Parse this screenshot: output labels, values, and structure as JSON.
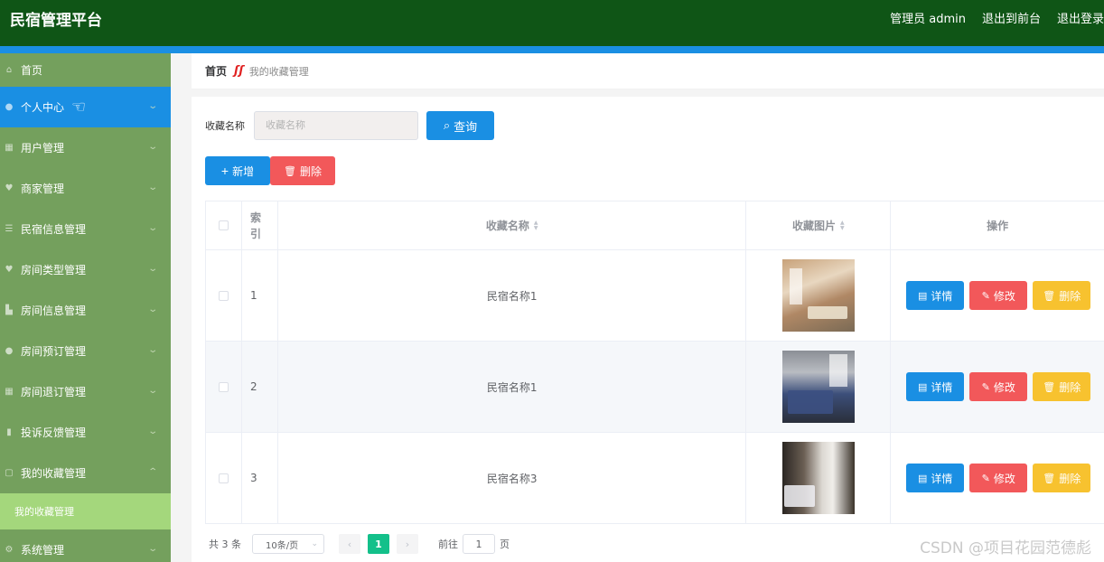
{
  "header": {
    "brand": "民宿管理平台",
    "user": "管理员 admin",
    "to_front": "退出到前台",
    "logout": "退出登录"
  },
  "sidebar": {
    "items": [
      {
        "label": "首页",
        "icon": "home-icon"
      },
      {
        "label": "个人中心",
        "icon": "user-icon"
      },
      {
        "label": "用户管理",
        "icon": "grid-icon"
      },
      {
        "label": "商家管理",
        "icon": "shop-icon"
      },
      {
        "label": "民宿信息管理",
        "icon": "list-icon"
      },
      {
        "label": "房间类型管理",
        "icon": "tag-icon"
      },
      {
        "label": "房间信息管理",
        "icon": "room-icon"
      },
      {
        "label": "房间预订管理",
        "icon": "booking-icon"
      },
      {
        "label": "房间退订管理",
        "icon": "cancel-icon"
      },
      {
        "label": "投诉反馈管理",
        "icon": "chart-icon"
      },
      {
        "label": "我的收藏管理",
        "icon": "star-icon"
      }
    ],
    "submenu_active": "我的收藏管理",
    "system": "系统管理",
    "active_color": "#1a8fe3"
  },
  "breadcrumb": {
    "home": "首页",
    "current": "我的收藏管理"
  },
  "search": {
    "label": "收藏名称",
    "placeholder": "收藏名称",
    "button": "查询"
  },
  "actions": {
    "add": "新增",
    "delete": "删除"
  },
  "table": {
    "headers": {
      "index": "索引",
      "name": "收藏名称",
      "image": "收藏图片",
      "ops": "操作"
    },
    "rows": [
      {
        "index": "1",
        "name": "民宿名称1"
      },
      {
        "index": "2",
        "name": "民宿名称1"
      },
      {
        "index": "3",
        "name": "民宿名称3"
      }
    ],
    "op_labels": {
      "detail": "详情",
      "edit": "修改",
      "delete": "删除"
    }
  },
  "pager": {
    "total": "共 3 条",
    "page_size": "10条/页",
    "current_page": "1",
    "goto_label": "前往",
    "goto_value": "1",
    "page_suffix": "页"
  },
  "watermark": "CSDN @项目花园范德彪"
}
